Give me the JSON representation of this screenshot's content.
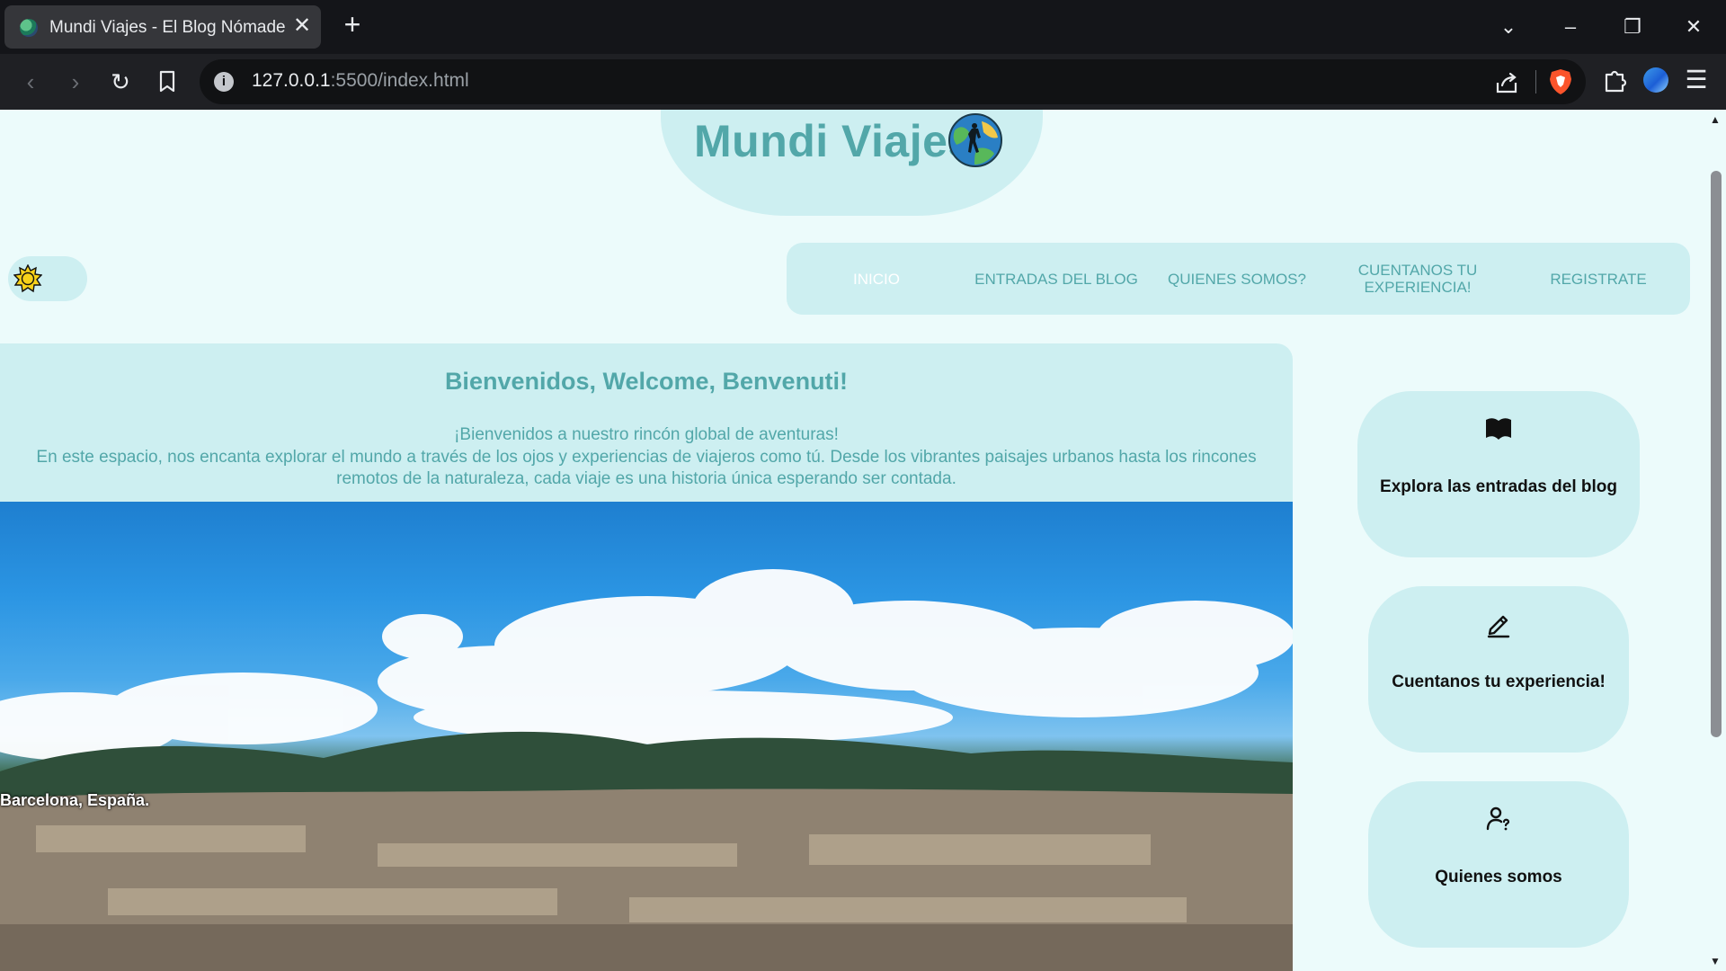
{
  "browser": {
    "tab_title": "Mundi Viajes - El Blog Nómade",
    "url_host": "127.0.0.1",
    "url_rest": ":5500/index.html"
  },
  "site": {
    "logo_text": "Mundi Viajes",
    "nav": [
      {
        "label": "INICIO",
        "active": true
      },
      {
        "label": "ENTRADAS DEL BLOG",
        "active": false
      },
      {
        "label": "QUIENES SOMOS?",
        "active": false
      },
      {
        "label": "CUENTANOS TU EXPERIENCIA!",
        "active": false
      },
      {
        "label": "REGISTRATE",
        "active": false
      }
    ],
    "welcome": {
      "title": "Bienvenidos, Welcome, Benvenuti!",
      "lead": "¡Bienvenidos a nuestro rincón global de aventuras!",
      "body": "En este espacio, nos encanta explorar el mundo a través de los ojos y experiencias de viajeros como tú. Desde los vibrantes paisajes urbanos hasta los rincones remotos de la naturaleza, cada viaje es una historia única esperando ser contada."
    },
    "hero_caption": "Barcelona, España.",
    "cards": [
      {
        "label": "Explora las entradas del blog",
        "icon": "book-icon"
      },
      {
        "label": "Cuentanos tu experiencia!",
        "icon": "pencil-icon"
      },
      {
        "label": "Quienes somos",
        "icon": "user-question-icon"
      }
    ]
  },
  "colors": {
    "page_bg": "#ecfbfb",
    "panel_bg": "#cdeff1",
    "accent_text": "#52a7a9"
  }
}
